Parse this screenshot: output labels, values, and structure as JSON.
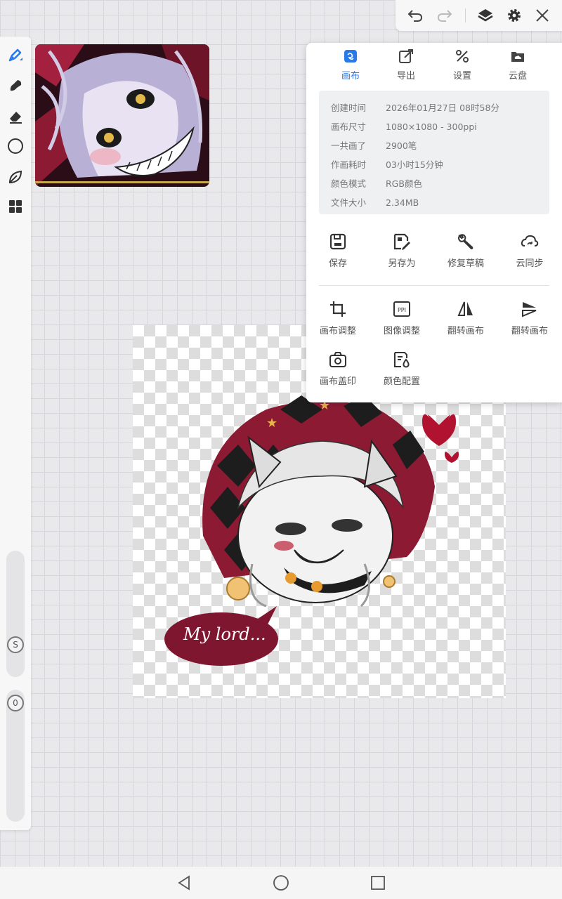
{
  "colors": {
    "accent": "#2979e8",
    "panel_bg": "#ffffff",
    "info_bg": "#eef0f2",
    "maroon": "#8c1a33"
  },
  "left_toolbar": {
    "tools": [
      "brush-icon",
      "smudge-icon",
      "eraser-icon",
      "shape-circle-icon",
      "leaf-icon",
      "grid-icon"
    ],
    "size_slider_label": "S",
    "opacity_slider_label": "0"
  },
  "top_toolbar": {
    "icons": [
      "undo-icon",
      "redo-icon",
      "layers-icon",
      "gear-icon",
      "close-icon"
    ]
  },
  "panel": {
    "tabs": [
      {
        "label": "画布",
        "icon": "canvas-icon",
        "active": true
      },
      {
        "label": "导出",
        "icon": "export-icon",
        "active": false
      },
      {
        "label": "设置",
        "icon": "settings-icon",
        "active": false
      },
      {
        "label": "云盘",
        "icon": "cloud-drive-icon",
        "active": false
      }
    ],
    "info": [
      {
        "key": "创建时间",
        "value": "2026年01月27日 08时58分"
      },
      {
        "key": "画布尺寸",
        "value": "1080×1080 - 300ppi"
      },
      {
        "key": "一共画了",
        "value": "2900笔"
      },
      {
        "key": "作画耗时",
        "value": "03小时15分钟"
      },
      {
        "key": "颜色模式",
        "value": "RGB颜色"
      },
      {
        "key": "文件大小",
        "value": "2.34MB"
      }
    ],
    "actions_row1": [
      {
        "label": "保存",
        "icon": "save-icon"
      },
      {
        "label": "另存为",
        "icon": "save-as-icon"
      },
      {
        "label": "修复草稿",
        "icon": "wrench-icon"
      },
      {
        "label": "云同步",
        "icon": "cloud-sync-icon"
      }
    ],
    "actions_row2": [
      {
        "label": "画布调整",
        "icon": "crop-icon"
      },
      {
        "label": "图像调整",
        "icon": "ppi-icon"
      },
      {
        "label": "翻转画布",
        "icon": "flip-horizontal-icon"
      },
      {
        "label": "翻转画布",
        "icon": "flip-vertical-icon"
      }
    ],
    "actions_row3": [
      {
        "label": "画布盖印",
        "icon": "stamp-camera-icon"
      },
      {
        "label": "颜色配置",
        "icon": "color-config-icon"
      }
    ]
  },
  "artwork": {
    "speech_text": "My lord..."
  },
  "navbar": {
    "icons": [
      "back-icon",
      "home-icon",
      "recents-icon"
    ]
  }
}
